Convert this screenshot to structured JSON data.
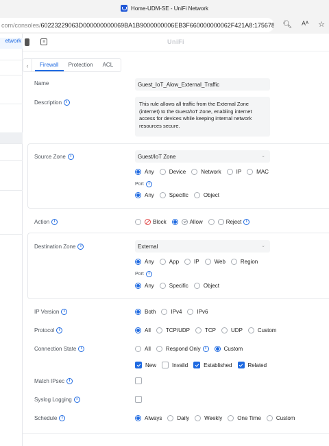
{
  "window": {
    "title": "Home-UDM-SE - UniFi Network"
  },
  "browser": {
    "url_visible": "com/consoles/60223229063D000000000069BA1B9000000006EB3F660000000062F421A8:175678...",
    "url_dim": "com/consoles/",
    "url_rest": "60223229063D000000000069BA1B9000000006EB3F660000000062F421A8:175678...",
    "icons": [
      "zoom-icon",
      "read-aloud-icon",
      "favorite-icon"
    ]
  },
  "left_nav": {
    "active_tab": "etwork"
  },
  "topbar": {
    "brand": "UniFi"
  },
  "tabs": [
    {
      "label": "Firewall",
      "active": true
    },
    {
      "label": "Protection",
      "active": false
    },
    {
      "label": "ACL",
      "active": false
    }
  ],
  "form": {
    "name": {
      "label": "Name",
      "value": "Guest_IoT_Alow_External_Traffic"
    },
    "description": {
      "label": "Description",
      "value": "This rule allows all traffic from the External Zone (internet) to the Guest/IoT Zone, enabling internet access for devices while keeping internal network resources secure."
    },
    "source_zone": {
      "label": "Source Zone",
      "value": "Guest/IoT Zone",
      "options": [
        "Any",
        "Device",
        "Network",
        "IP",
        "MAC"
      ],
      "selected": "Any",
      "port_label": "Port",
      "port_options": [
        "Any",
        "Specific",
        "Object"
      ],
      "port_selected": "Any"
    },
    "action": {
      "label": "Action",
      "options": [
        "Block",
        "Allow",
        "Reject"
      ],
      "selected": "Allow"
    },
    "destination_zone": {
      "label": "Destination Zone",
      "value": "External",
      "options": [
        "Any",
        "App",
        "IP",
        "Web",
        "Region"
      ],
      "selected": "Any",
      "port_label": "Port",
      "port_options": [
        "Any",
        "Specific",
        "Object"
      ],
      "port_selected": "Any"
    },
    "ip_version": {
      "label": "IP Version",
      "options": [
        "Both",
        "IPv4",
        "IPv6"
      ],
      "selected": "Both"
    },
    "protocol": {
      "label": "Protocol",
      "options": [
        "All",
        "TCP/UDP",
        "TCP",
        "UDP",
        "Custom"
      ],
      "selected": "All"
    },
    "connection_state": {
      "label": "Connection State",
      "options": [
        "All",
        "Respond Only",
        "Custom"
      ],
      "selected": "Custom",
      "states": [
        {
          "label": "New",
          "checked": true
        },
        {
          "label": "Invalid",
          "checked": false
        },
        {
          "label": "Established",
          "checked": true
        },
        {
          "label": "Related",
          "checked": true
        }
      ]
    },
    "match_ipsec": {
      "label": "Match IPsec",
      "checked": false
    },
    "syslog_logging": {
      "label": "Syslog Logging",
      "checked": false
    },
    "schedule": {
      "label": "Schedule",
      "options": [
        "Always",
        "Daily",
        "Weekly",
        "One Time",
        "Custom"
      ],
      "selected": "Always"
    }
  },
  "colors": {
    "accent": "#1f6ae1",
    "block": "#e04646"
  }
}
